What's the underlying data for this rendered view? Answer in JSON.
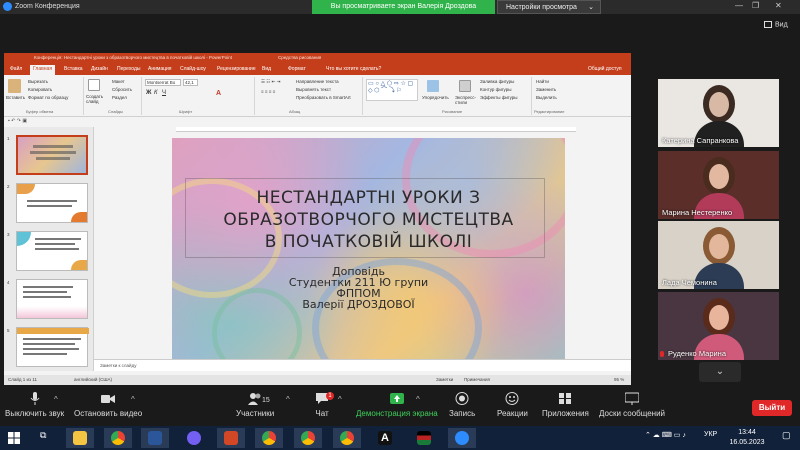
{
  "titlebar": {
    "app_title": "Zoom Конференция",
    "share_banner": "Вы просматриваете экран Валерія Дроздова",
    "view_settings": "Настройки просмотра",
    "view_mode": "Вид"
  },
  "ppt": {
    "window_title": "Конференція: Нестандартні уроки з образотворчого мистецтва в початковій школі - PowerPoint",
    "drawing_tools_label": "Средства рисования",
    "tabs": [
      "Файл",
      "Главная",
      "Вставка",
      "Дизайн",
      "Переходы",
      "Анимация",
      "Слайд-шоу",
      "Рецензирование",
      "Вид",
      "Формат",
      "Что вы хотите сделать?"
    ],
    "share_label": "Общий доступ",
    "ribbon": {
      "paste": "Вставить",
      "cut": "Вырезать",
      "copy": "Копировать",
      "format_painter": "Формат по образцу",
      "clipboard": "Буфер обмена",
      "new_slide": "Создать слайд",
      "layout": "Макет",
      "reset": "Сбросить",
      "section": "Раздел",
      "slides": "Слайды",
      "font_name": "Montserrat Bo",
      "font_size": "42,1",
      "font": "Шрифт",
      "text_direction": "Направление текста",
      "align_text": "Выровнять текст",
      "convert_smartart": "Преобразовать в SmartArt",
      "paragraph": "Абзац",
      "arrange": "Упорядочить",
      "quick_styles": "Экспресс-стили",
      "shape_fill": "Заливка фигуры",
      "shape_outline": "Контур фигуры",
      "shape_effects": "Эффекты фигуры",
      "drawing": "Рисование",
      "find": "Найти",
      "replace": "Заменить",
      "select": "Выделить",
      "editing": "Редактирование"
    },
    "thumb_numbers": [
      "1",
      "2",
      "3",
      "4",
      "5"
    ],
    "slide": {
      "title_lines": [
        "НЕСТАНДАРТНІ УРОКИ З",
        "ОБРАЗОТВОРЧОГО МИСТЕЦТВА",
        "В ПОЧАТКОВІЙ ШКОЛІ"
      ],
      "sub_lines": [
        "Доповідь",
        "Студентки 211 Ю групи",
        "ФППОМ",
        "Валерії ДРОЗДОВОЇ"
      ]
    },
    "notes_placeholder": "Заметки к слайду",
    "status_slide": "Слайд 1 из 11",
    "status_lang": "английский (США)",
    "status_notes": "Заметки",
    "status_comments": "Примечания",
    "zoom": "95 %"
  },
  "participants": [
    {
      "name": "Катерина Сапранкова",
      "muted": false,
      "bg": "#eae6e2",
      "face": "#d8b9a6",
      "hair": "#3b2a22",
      "top": "#202020"
    },
    {
      "name": "Марина Нестеренко",
      "muted": false,
      "bg": "#5b2e2a",
      "face": "#e2b8a0",
      "hair": "#4a2c1e",
      "top": "#b23b5a"
    },
    {
      "name": "Лада Чемонина",
      "muted": false,
      "bg": "#d8d2c8",
      "face": "#e3b79b",
      "hair": "#8a5a34",
      "top": "#2c3c55"
    },
    {
      "name": "Руденко Марина",
      "muted": true,
      "bg": "#4a3640",
      "face": "#e8b59c",
      "hair": "#5a2a1a",
      "top": "#d05a7a"
    }
  ],
  "toolbar": {
    "mute": "Выключить звук",
    "video": "Остановить видео",
    "participants": "Участники",
    "participants_count": "15",
    "chat": "Чат",
    "chat_badge": "1",
    "share": "Демонстрация экрана",
    "record": "Запись",
    "reactions": "Реакции",
    "apps": "Приложения",
    "whiteboards": "Доски сообщений",
    "leave": "Выйти"
  },
  "taskbar": {
    "lang": "УКР",
    "time": "13:44",
    "date": "16.05.2023",
    "apps": [
      "file-explorer",
      "chrome",
      "word",
      "viber",
      "powerpoint",
      "chrome",
      "chrome",
      "chrome",
      "app-a",
      "flag-app",
      "zoom"
    ]
  },
  "colors": {
    "ppt_accent": "#c43e1c",
    "zoom_green": "#2fb34a",
    "leave_red": "#e12828",
    "taskbar": "#12213a"
  }
}
